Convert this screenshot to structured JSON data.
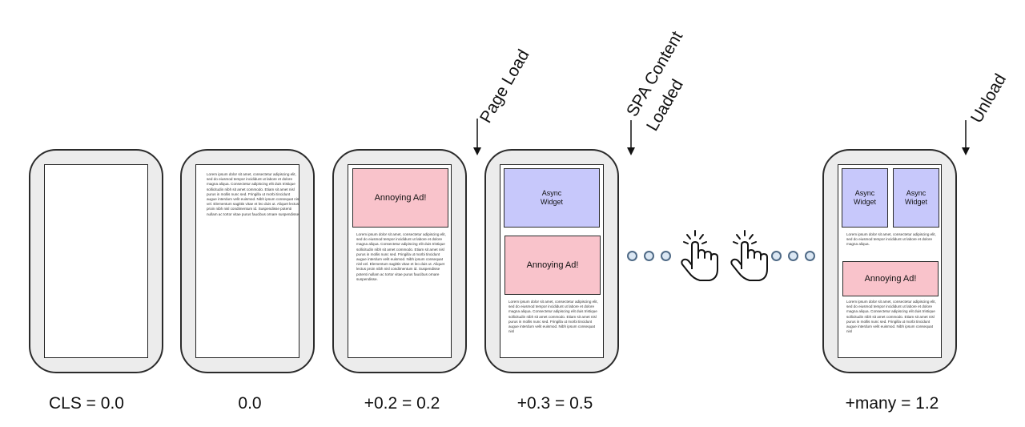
{
  "frames": [
    {
      "score": "CLS = 0.0"
    },
    {
      "score": "0.0",
      "text": "Lorem ipsum dolor sit amet, consectetur adipiscing elit, sed do eiusmod tempor incididunt ut labore et dolore magna aliqua. Consectetur adipiscing elit duis tristique sollicitudin nibh sit amet commodo. Etiam sit amet nisl purus in mollis nunc sed. Fringilla ut morbi tincidunt augue interdum velit euismod. Nibh ipsum consequat nisl vel. Elementum sagittis vitae et leo duis ut. Aliquet lectus proin nibh nisl condimentum id. Suspendisse potenti nullam ac tortor vitae purus faucibus ornare suspendisse."
    },
    {
      "score": "+0.2 = 0.2",
      "ad": "Annoying Ad!",
      "text": "Lorem ipsum dolor sit amet, consectetur adipiscing elit, sed do eiusmod tempor incididunt ut labore et dolore magna aliqua. Consectetur adipiscing elit duis tristique sollicitudin nibh sit amet commodo. Etiam sit amet nisl purus in mollis nunc sed. Fringilla ut morbi tincidunt augue interdum velit euismod. Nibh ipsum consequat nisl vel. Elementum sagittis vitae et leo duis ut. Aliquet lectus proin nibh nisl condimentum id. Suspendisse potenti nullam ac tortor vitae purus faucibus ornare suspendisse."
    },
    {
      "score": "+0.3 = 0.5",
      "widget": "Async\nWidget",
      "ad": "Annoying Ad!",
      "text": "Lorem ipsum dolor sit amet, consectetur adipiscing elit, sed do eiusmod tempor incididunt ut labore et dolore magna aliqua. Consectetur adipiscing elit duis tristique sollicitudin nibh sit amet commodo. Etiam sit amet nisl purus in mollis nunc sed. Fringilla ut morbi tincidunt augue interdum velit euismod. Nibh ipsum consequat nisl"
    },
    {
      "score": "+many = 1.2",
      "widget_left": "Async\nWidget",
      "widget_right": "Async\nWidget",
      "text_top": "Lorem ipsum dolor sit amet, consectetur adipiscing elit, sed do eiusmod tempor incididunt ut labore et dolore magna aliqua.",
      "ad": "Annoying Ad!",
      "text_bottom": "Lorem ipsum dolor sit amet, consectetur adipiscing elit, sed do eiusmod tempor incididunt ut labore et dolore magna aliqua. Consectetur adipiscing elit duis tristique sollicitudin nibh sit amet commodo. Etiam sit amet nisl purus in mollis nunc sed. Fringilla ut morbi tincidunt augue interdum velit euismod. Nibh ipsum consequat nisl"
    }
  ],
  "events": {
    "page_load": "Page Load",
    "spa_loaded_line1": "SPA Content",
    "spa_loaded_line2": "Loaded",
    "unload": "Unload"
  },
  "icons": [
    "ellipsis-dots-icon",
    "tap-hand-icon"
  ],
  "colors": {
    "ad": "#f9c3cb",
    "widget": "#c7c8fb",
    "phone": "#ececec",
    "dot": "#dbe7f3"
  }
}
